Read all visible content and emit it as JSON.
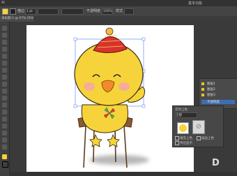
{
  "app": {
    "menu_items": [
      "",
      "",
      "",
      "",
      ""
    ],
    "right_label": "基本功能"
  },
  "options": {
    "stroke_label": "描边",
    "stroke_value": "1 pt",
    "opacity_label": "不透明度",
    "opacity_value": "100%",
    "style_label": "样式"
  },
  "document_tab": {
    "label": "未标题-1 @ 67% (RGB/预览)"
  },
  "panel_layers": {
    "items": [
      {
        "label": "图层1"
      },
      {
        "label": "图层2"
      },
      {
        "label": "图层3"
      },
      {
        "label": "不透明度"
      }
    ]
  },
  "panel_live_paint": {
    "title": "实时上色",
    "dropdown": "全部",
    "option_fill": "填充上色",
    "option_stroke": "描边上色",
    "option_highlight": "突出显示",
    "footer": "上色"
  },
  "watermark": {
    "text": "D"
  },
  "colors": {
    "accent": "#f6d33a",
    "hat": "#d9322b",
    "canvas_bg": "#3a3a3a"
  }
}
